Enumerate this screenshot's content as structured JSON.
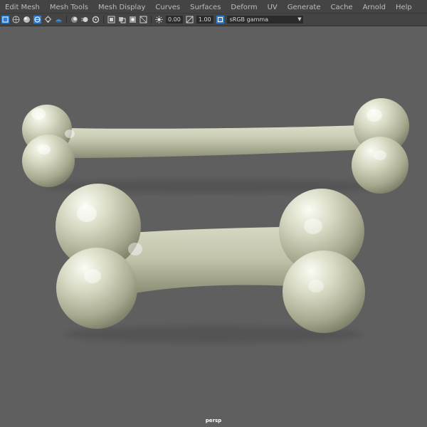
{
  "menubar": {
    "items": [
      "Edit Mesh",
      "Mesh Tools",
      "Mesh Display",
      "Curves",
      "Surfaces",
      "Deform",
      "UV",
      "Generate",
      "Cache",
      "Arnold",
      "Help"
    ]
  },
  "toolbar": {
    "icons": [
      "panel-layout-icon",
      "wireframe-shade-icon",
      "smooth-shade-icon",
      "textured-icon",
      "lights-icon",
      "shadows-icon",
      "ambient-occlusion-icon",
      "motion-blur-icon",
      "anti-alias-icon",
      "isolate-select-icon",
      "xray-icon",
      "xray-joints-icon",
      "backface-icon",
      "exposure-icon",
      "gamma-icon"
    ],
    "exposure_value": "0.00",
    "gamma_value": "1.00",
    "color_space": "sRGB gamma"
  },
  "viewport": {
    "background_color": "#5f5f5f",
    "camera": "persp",
    "objects": [
      "bone-mesh-long",
      "bone-mesh-short"
    ]
  }
}
